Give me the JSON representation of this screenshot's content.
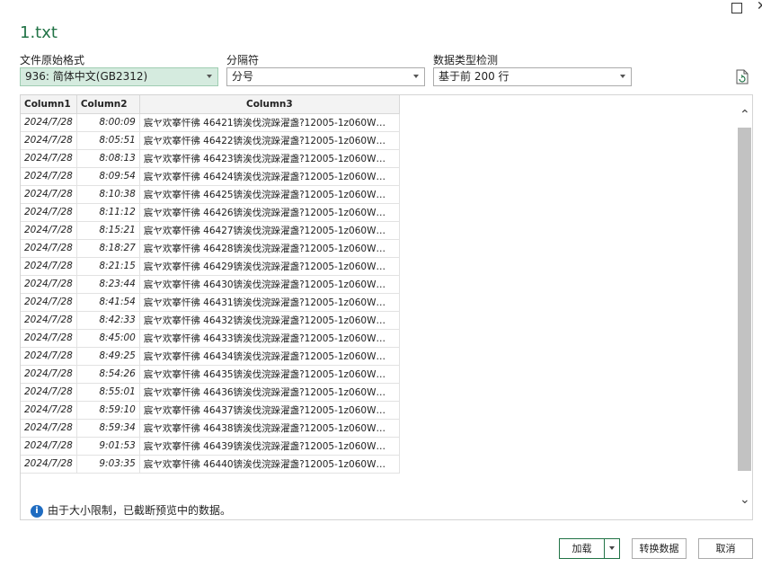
{
  "window": {
    "title": "1.txt"
  },
  "options": {
    "file_origin_label": "文件原始格式",
    "file_origin_value": "936: 简体中文(GB2312)",
    "delimiter_label": "分隔符",
    "delimiter_value": "分号",
    "type_detect_label": "数据类型检测",
    "type_detect_value": "基于前 200 行"
  },
  "table": {
    "headers": [
      "Column1",
      "Column2",
      "Column3"
    ],
    "rows": [
      [
        "2024/7/28",
        "8:00:09",
        "宸ヤ欢搴忓彿 46421锛涘伐浣跺濯盏?12005-1z060W…"
      ],
      [
        "2024/7/28",
        "8:05:51",
        "宸ヤ欢搴忓彿 46422锛涘伐浣跺濯盏?12005-1z060W…"
      ],
      [
        "2024/7/28",
        "8:08:13",
        "宸ヤ欢搴忓彿 46423锛涘伐浣跺濯盏?12005-1z060W…"
      ],
      [
        "2024/7/28",
        "8:09:54",
        "宸ヤ欢搴忓彿 46424锛涘伐浣跺濯盏?12005-1z060W…"
      ],
      [
        "2024/7/28",
        "8:10:38",
        "宸ヤ欢搴忓彿 46425锛涘伐浣跺濯盏?12005-1z060W…"
      ],
      [
        "2024/7/28",
        "8:11:12",
        "宸ヤ欢搴忓彿 46426锛涘伐浣跺濯盏?12005-1z060W…"
      ],
      [
        "2024/7/28",
        "8:15:21",
        "宸ヤ欢搴忓彿 46427锛涘伐浣跺濯盏?12005-1z060W…"
      ],
      [
        "2024/7/28",
        "8:18:27",
        "宸ヤ欢搴忓彿 46428锛涘伐浣跺濯盏?12005-1z060W…"
      ],
      [
        "2024/7/28",
        "8:21:15",
        "宸ヤ欢搴忓彿 46429锛涘伐浣跺濯盏?12005-1z060W…"
      ],
      [
        "2024/7/28",
        "8:23:44",
        "宸ヤ欢搴忓彿 46430锛涘伐浣跺濯盏?12005-1z060W…"
      ],
      [
        "2024/7/28",
        "8:41:54",
        "宸ヤ欢搴忓彿 46431锛涘伐浣跺濯盏?12005-1z060W…"
      ],
      [
        "2024/7/28",
        "8:42:33",
        "宸ヤ欢搴忓彿 46432锛涘伐浣跺濯盏?12005-1z060W…"
      ],
      [
        "2024/7/28",
        "8:45:00",
        "宸ヤ欢搴忓彿 46433锛涘伐浣跺濯盏?12005-1z060W…"
      ],
      [
        "2024/7/28",
        "8:49:25",
        "宸ヤ欢搴忓彿 46434锛涘伐浣跺濯盏?12005-1z060W…"
      ],
      [
        "2024/7/28",
        "8:54:26",
        "宸ヤ欢搴忓彿 46435锛涘伐浣跺濯盏?12005-1z060W…"
      ],
      [
        "2024/7/28",
        "8:55:01",
        "宸ヤ欢搴忓彿 46436锛涘伐浣跺濯盏?12005-1z060W…"
      ],
      [
        "2024/7/28",
        "8:59:10",
        "宸ヤ欢搴忓彿 46437锛涘伐浣跺濯盏?12005-1z060W…"
      ],
      [
        "2024/7/28",
        "8:59:34",
        "宸ヤ欢搴忓彿 46438锛涘伐浣跺濯盏?12005-1z060W…"
      ],
      [
        "2024/7/28",
        "9:01:53",
        "宸ヤ欢搴忓彿 46439锛涘伐浣跺濯盏?12005-1z060W…"
      ],
      [
        "2024/7/28",
        "9:03:35",
        "宸ヤ欢搴忓彿 46440锛涘伐浣跺濯盏?12005-1z060W…"
      ]
    ]
  },
  "notice": {
    "text": "由于大小限制，已截断预览中的数据。",
    "icon": "info-icon"
  },
  "buttons": {
    "load_label": "加载",
    "transform_label": "转换数据",
    "cancel_label": "取消"
  },
  "colors": {
    "accent": "#217346",
    "selected_bg": "#d5ebdf"
  }
}
